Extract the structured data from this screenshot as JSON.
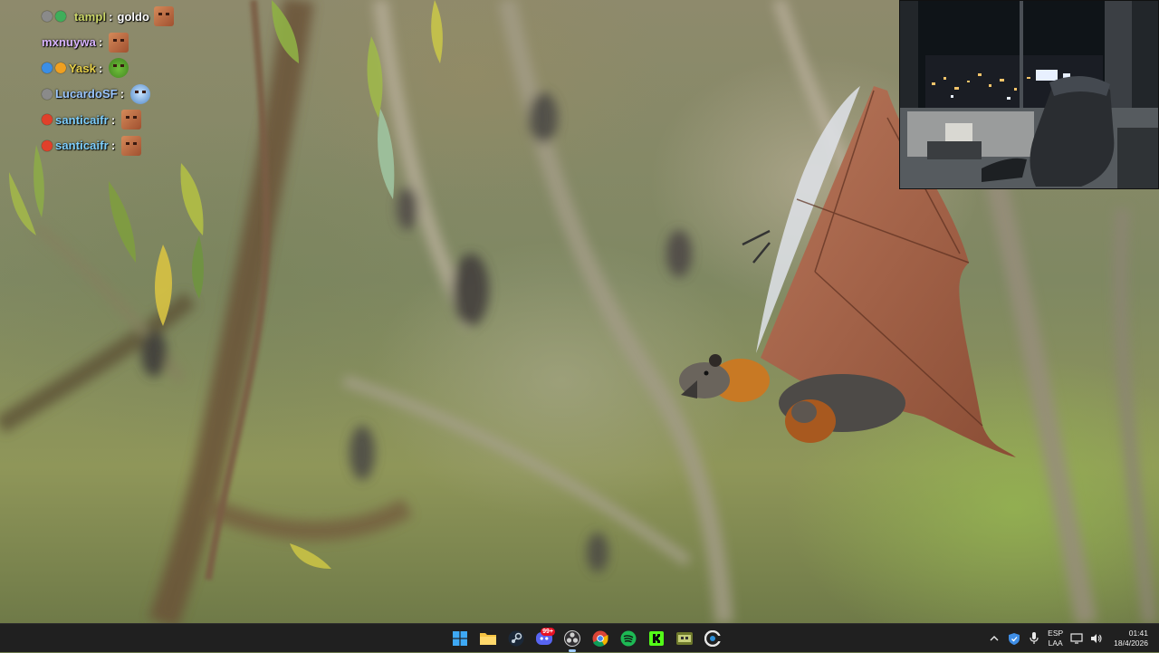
{
  "chat": {
    "messages": [
      {
        "username": "tampl",
        "text": "goldo",
        "badges": [
          "mod-badge",
          "sub-badge"
        ],
        "emote": "goldo-emote",
        "name_color": "#cdd86a"
      },
      {
        "username": "mxnuywa",
        "text": "",
        "badges": [],
        "emote": "goldo-emote",
        "name_color": "#d9b4ff"
      },
      {
        "username": "Yask",
        "text": "",
        "badges": [
          "blue-badge",
          "orange-badge"
        ],
        "emote": "pepe-emote",
        "name_color": "#e8d24a"
      },
      {
        "username": "LucardoSF",
        "text": "",
        "badges": [
          "mod-badge"
        ],
        "emote": "ghost-emote",
        "name_color": "#9cc7ff"
      },
      {
        "username": "santicaifr",
        "text": "",
        "badges": [
          "red-badge"
        ],
        "emote": "goldo-emote",
        "name_color": "#7fd0ff"
      },
      {
        "username": "santicaifr",
        "text": "",
        "badges": [
          "red-badge"
        ],
        "emote": "goldo-emote",
        "name_color": "#7fd0ff"
      }
    ],
    "separator": ":"
  },
  "webcam": {
    "description_icon": "webcam-feed"
  },
  "taskbar": {
    "apps": [
      {
        "name": "start",
        "icon": "windows-icon"
      },
      {
        "name": "file-explorer",
        "icon": "folder-icon"
      },
      {
        "name": "steam",
        "icon": "steam-icon"
      },
      {
        "name": "discord",
        "icon": "discord-icon",
        "badge": "99+"
      },
      {
        "name": "obs",
        "icon": "obs-icon",
        "active": true
      },
      {
        "name": "chrome",
        "icon": "chrome-icon"
      },
      {
        "name": "spotify",
        "icon": "spotify-icon"
      },
      {
        "name": "kick",
        "icon": "kick-icon"
      },
      {
        "name": "game-app",
        "icon": "game-icon"
      },
      {
        "name": "ccleaner",
        "icon": "ccleaner-icon"
      }
    ],
    "tray": {
      "lang_top": "ESP",
      "lang_bottom": "LAA",
      "time": "01:41",
      "date": "18/4/2026"
    }
  },
  "colors": {
    "taskbar_bg": "#202020",
    "accent": "#9ecbff"
  }
}
